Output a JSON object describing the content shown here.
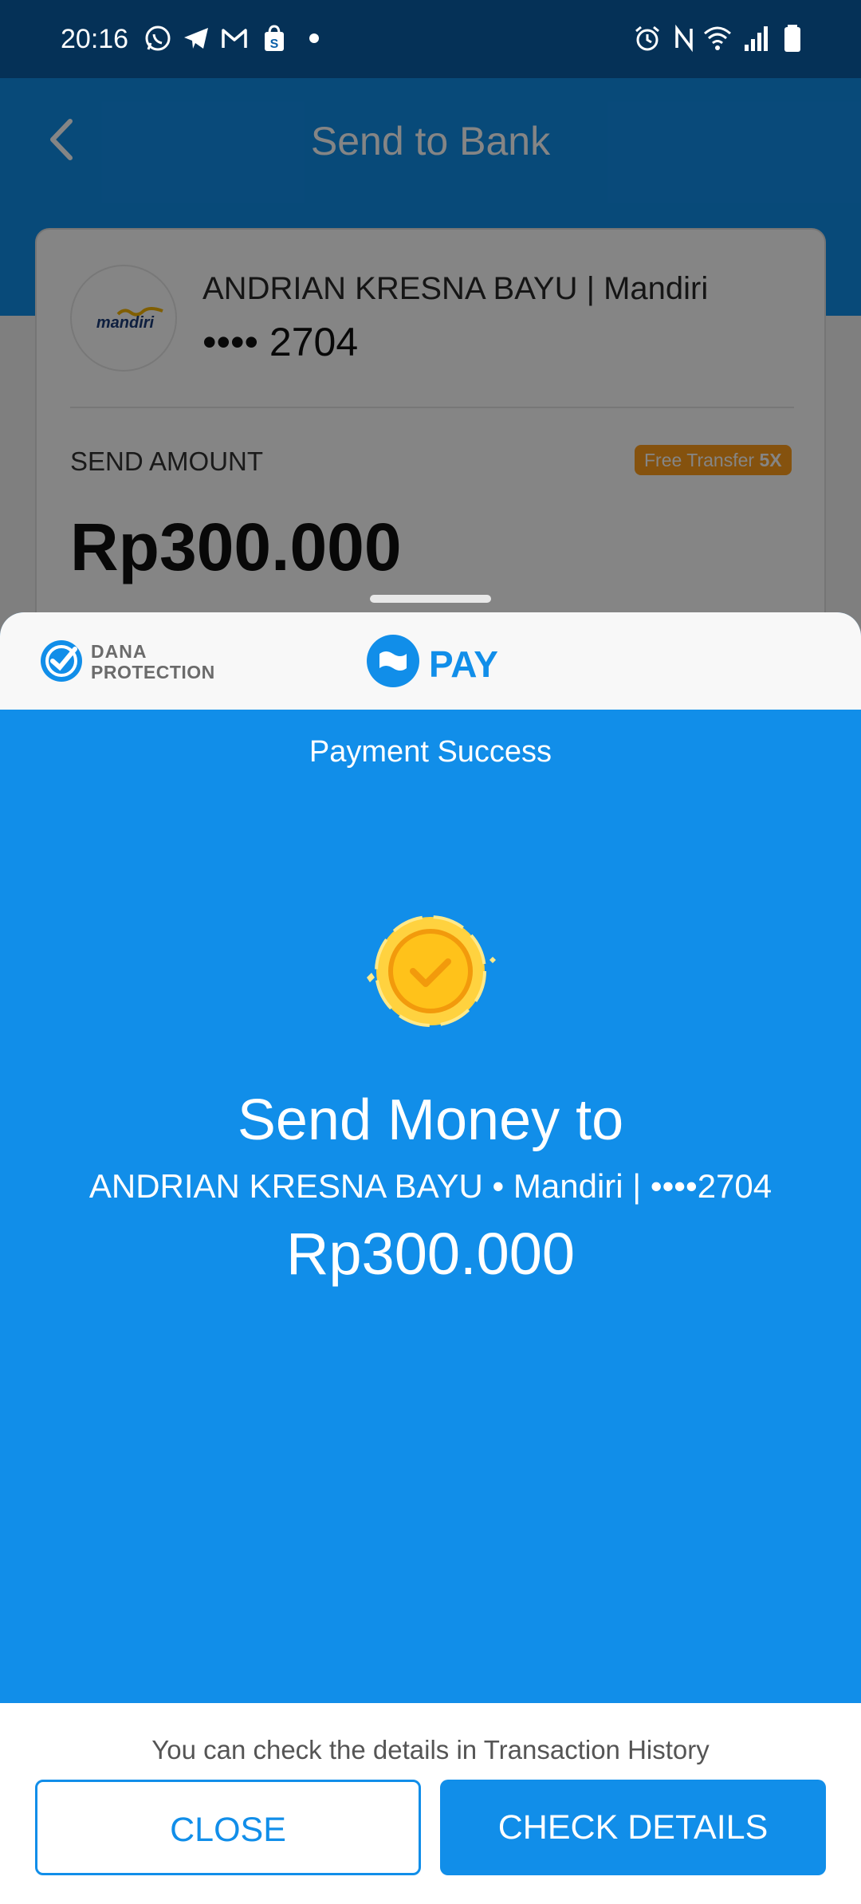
{
  "status_bar": {
    "time": "20:16",
    "left_icons": [
      "whatsapp-icon",
      "telegram-icon",
      "gmail-icon",
      "shopping-bag-icon",
      "notification-dot-icon"
    ],
    "right_icons": [
      "alarm-icon",
      "nfc-icon",
      "wifi-icon",
      "signal-icon",
      "battery-icon"
    ]
  },
  "header": {
    "title": "Send to Bank",
    "back_icon": "chevron-left-icon"
  },
  "bank_card": {
    "bank_logo_text": "mandiri",
    "recipient": "ANDRIAN KRESNA BAYU | Mandiri",
    "account": "•••• 2704",
    "send_amount_label": "SEND AMOUNT",
    "free_transfer_label": "Free Transfer",
    "free_transfer_count": "5X",
    "amount": "Rp300.000"
  },
  "sheet": {
    "protection_line1": "DANA",
    "protection_line2": "PROTECTION",
    "pay_label": "PAY",
    "status": "Payment Success",
    "title": "Send Money to",
    "recipient_line": "ANDRIAN KRESNA BAYU • Mandiri | ••••2704",
    "amount": "Rp300.000",
    "footer_note": "You can check the details in Transaction History",
    "close_label": "CLOSE",
    "check_details_label": "CHECK DETAILS"
  },
  "colors": {
    "primary": "#118ee9",
    "coin": "#ffd23f",
    "badge": "#ff9d1b"
  }
}
